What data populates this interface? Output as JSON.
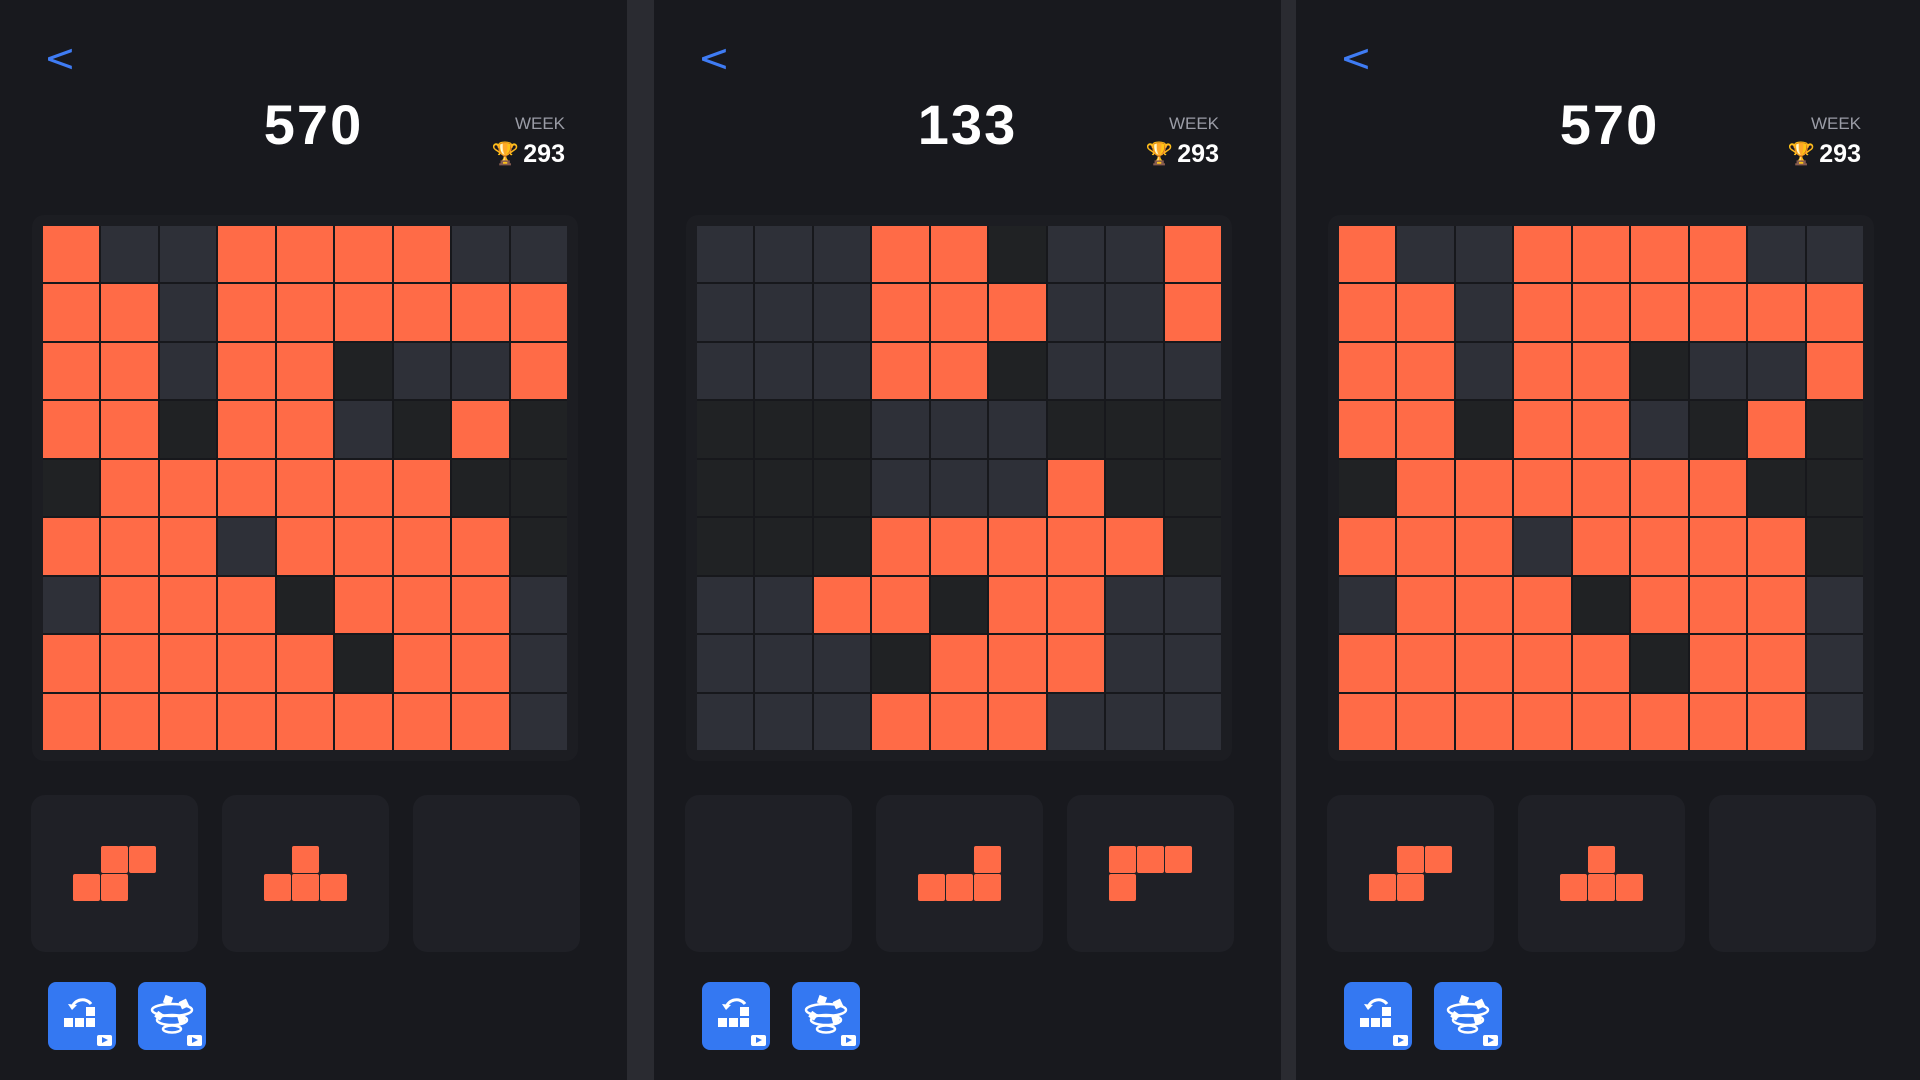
{
  "panels": [
    {
      "back_label": "<",
      "score": "570",
      "week_label": "WEEK",
      "best_score": "293",
      "trophy_icon": "trophy-icon",
      "board": [
        "FDDFFFFDD",
        "FFDFFFFFF",
        "FFDFFKDDF",
        "FFKFFDKFK",
        "KFFFFFFKK",
        "FFFDFFFFK",
        "DFFFKFFFD",
        "FFFFFKFFD",
        "FFFFFFFFD"
      ],
      "pieces": [
        [
          "EFF",
          "FFE"
        ],
        [
          "EFE",
          "FFF"
        ],
        []
      ],
      "powerups": [
        {
          "name": "undo-powerup",
          "icon": "undo-blocks-icon",
          "badge": "video-ad-icon"
        },
        {
          "name": "shuffle-powerup",
          "icon": "tornado-shuffle-icon",
          "badge": "video-ad-icon"
        }
      ]
    },
    {
      "back_label": "<",
      "score": "133",
      "week_label": "WEEK",
      "best_score": "293",
      "trophy_icon": "trophy-icon",
      "board": [
        "DDDFFKDDF",
        "DDDFFFDDF",
        "DDDFFKDDD",
        "KKKDDDKKK",
        "KKKDDDFKK",
        "KKKFFFFFK",
        "DDFFKFFDD",
        "DDDKFFFDD",
        "DDDFFFDDD"
      ],
      "pieces": [
        [],
        [
          "EEF",
          "FFF"
        ],
        [
          "FFF",
          "FEE"
        ]
      ],
      "powerups": [
        {
          "name": "undo-powerup",
          "icon": "undo-blocks-icon",
          "badge": "video-ad-icon"
        },
        {
          "name": "shuffle-powerup",
          "icon": "tornado-shuffle-icon",
          "badge": "video-ad-icon"
        }
      ]
    },
    {
      "back_label": "<",
      "score": "570",
      "week_label": "WEEK",
      "best_score": "293",
      "trophy_icon": "trophy-icon",
      "board": [
        "FDDFFFFDD",
        "FFDFFFFFF",
        "FFDFFKDDF",
        "FFKFFDKFK",
        "KFFFFFFKK",
        "FFFDFFFFK",
        "DFFFKFFFD",
        "FFFFFKFFD",
        "FFFFFFFFD"
      ],
      "pieces": [
        [
          "EFF",
          "FFE"
        ],
        [
          "EFE",
          "FFF"
        ],
        []
      ],
      "powerups": [
        {
          "name": "undo-powerup",
          "icon": "undo-blocks-icon",
          "badge": "video-ad-icon"
        },
        {
          "name": "shuffle-powerup",
          "icon": "tornado-shuffle-icon",
          "badge": "video-ad-icon"
        }
      ]
    }
  ],
  "colors": {
    "filled": "#ff6b47",
    "empty": "#2e3038",
    "empty_dark": "#202224",
    "accent": "#3478f2",
    "back_arrow": "#3f7cf4"
  }
}
